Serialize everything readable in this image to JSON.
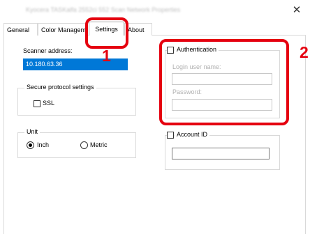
{
  "window": {
    "title": "Kyocera TASKalfa 2552ci 552 Scan Network Properties",
    "close_glyph": "✕"
  },
  "tabs": [
    {
      "label": "General"
    },
    {
      "label": "Color Manageme"
    },
    {
      "label": "Settings"
    },
    {
      "label": "About"
    }
  ],
  "scanner": {
    "label": "Scanner address:",
    "value": "10.180.63.36"
  },
  "secure": {
    "group_label": "Secure protocol settings",
    "ssl_label": "SSL"
  },
  "unit": {
    "group_label": "Unit",
    "inch_label": "Inch",
    "metric_label": "Metric",
    "selected": "Inch"
  },
  "auth": {
    "label": "Authentication",
    "login_label": "Login user name:",
    "password_label": "Password:"
  },
  "account": {
    "label": "Account ID"
  },
  "annotations": {
    "callout_1": "1",
    "callout_2": "2",
    "highlight_color": "#e5000f"
  }
}
